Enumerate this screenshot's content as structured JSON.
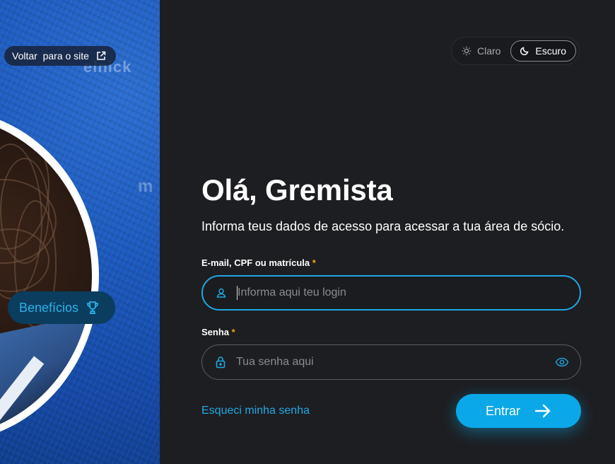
{
  "hero": {
    "back_link": {
      "label": "Voltar  para o site",
      "icon": "external-link-icon"
    },
    "benefits_button": {
      "label": "Benefícios",
      "icon": "trophy-icon"
    },
    "background_text": [
      "elnick",
      "m"
    ]
  },
  "theme": {
    "light_label": "Claro",
    "dark_label": "Escuro",
    "selected": "Escuro"
  },
  "login": {
    "title": "Olá, Gremista",
    "subtitle": "Informa teus dados de acesso para acessar a tua área de sócio.",
    "login_field": {
      "label": "E-mail, CPF ou matrícula",
      "required_mark": "*",
      "placeholder": "Informa aqui teu login",
      "value": ""
    },
    "password_field": {
      "label": "Senha",
      "required_mark": "*",
      "placeholder": "Tua senha aqui",
      "value": ""
    },
    "forgot_link": "Esqueci minha senha",
    "submit_label": "Entrar"
  },
  "colors": {
    "accent": "#0aa8e8",
    "background": "#1d1e21",
    "required": "#f0a31a",
    "hero_blue": "#1d5bbf"
  }
}
